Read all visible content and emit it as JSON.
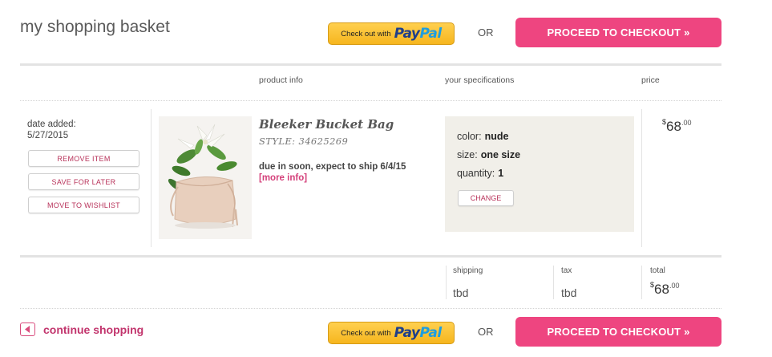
{
  "header": {
    "title": "my shopping basket",
    "paypal": {
      "prefix": "Check out with",
      "brand_part1": "Pay",
      "brand_part2": "Pal"
    },
    "or_text": "OR",
    "checkout_label": "PROCEED TO CHECKOUT »"
  },
  "columns": {
    "product_info": "product info",
    "your_specifications": "your specifications",
    "price": "price"
  },
  "item": {
    "date_added_label": "date added:",
    "date_added": "5/27/2015",
    "actions": {
      "remove": "REMOVE ITEM",
      "save": "SAVE FOR LATER",
      "wishlist": "MOVE TO WISHLIST"
    },
    "name": "Bleeker Bucket Bag",
    "style": "STYLE: 34625269",
    "ship_note": "due in soon, expect to ship 6/4/15",
    "more_info": "[more info]",
    "specs": {
      "color_label": "color:",
      "color_value": "nude",
      "size_label": "size:",
      "size_value": "one size",
      "quantity_label": "quantity:",
      "quantity_value": "1",
      "change_label": "CHANGE"
    },
    "price": {
      "currency": "$",
      "whole": "68",
      "cents": ".00"
    }
  },
  "summary": {
    "shipping_label": "shipping",
    "shipping_value": "tbd",
    "tax_label": "tax",
    "tax_value": "tbd",
    "total_label": "total",
    "total": {
      "currency": "$",
      "whole": "68",
      "cents": ".00"
    }
  },
  "footer": {
    "continue_label": "continue shopping",
    "paypal": {
      "prefix": "Check out with",
      "brand_part1": "Pay",
      "brand_part2": "Pal"
    },
    "or_text": "OR",
    "checkout_label": "PROCEED TO CHECKOUT »"
  },
  "colors": {
    "accent_pink": "#ee4580",
    "paypal_yellow": "#f6b61e",
    "spec_bg": "#f1efe9"
  },
  "icons": {
    "continue": "left-triangle-icon"
  }
}
